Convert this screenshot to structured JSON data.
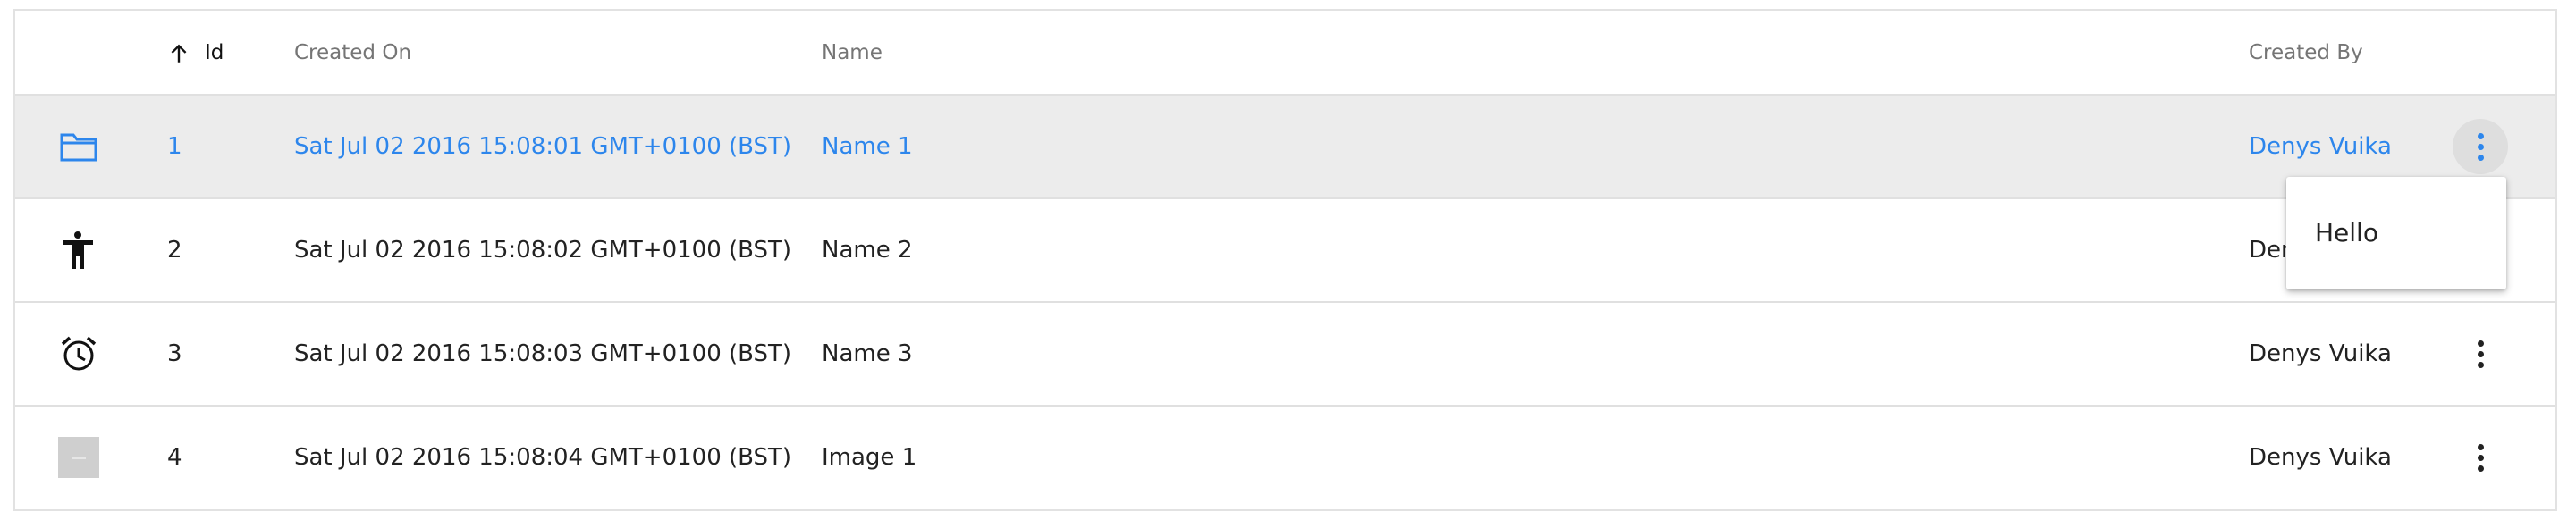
{
  "header": {
    "id_label": "Id",
    "created_on_label": "Created On",
    "name_label": "Name",
    "created_by_label": "Created By",
    "sort_icon": "arrow-up-icon"
  },
  "rows": [
    {
      "icon": "folder-icon",
      "id": "1",
      "created_on": "Sat Jul 02 2016 15:08:01 GMT+0100 (BST)",
      "name": "Name 1",
      "created_by": "Denys Vuika",
      "selected": true
    },
    {
      "icon": "accessibility-icon",
      "id": "2",
      "created_on": "Sat Jul 02 2016 15:08:02 GMT+0100 (BST)",
      "name": "Name 2",
      "created_by": "Denys Vuika",
      "selected": false
    },
    {
      "icon": "alarm-clock-icon",
      "id": "3",
      "created_on": "Sat Jul 02 2016 15:08:03 GMT+0100 (BST)",
      "name": "Name 3",
      "created_by": "Denys Vuika",
      "selected": false
    },
    {
      "icon": "image-thumbnail-icon",
      "id": "4",
      "created_on": "Sat Jul 02 2016 15:08:04 GMT+0100 (BST)",
      "name": "Image 1",
      "created_by": "Denys Vuika",
      "selected": false
    }
  ],
  "context_menu": {
    "items": [
      "Hello"
    ]
  },
  "colors": {
    "accent": "#2d86ec",
    "selected_row_bg": "#ececec"
  }
}
